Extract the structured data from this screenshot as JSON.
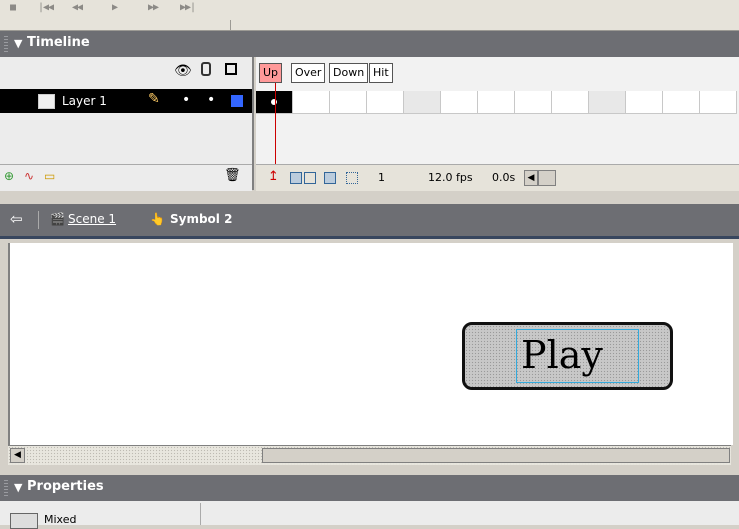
{
  "toolbar": {
    "buttons": [
      "stop-icon",
      "rewind-icon",
      "step-back-icon",
      "play-icon",
      "step-forward-icon",
      "go-end-icon"
    ]
  },
  "timeline": {
    "title": "Timeline",
    "layer": {
      "name": "Layer 1",
      "color": "#3366ff"
    },
    "frame_labels": [
      "Up",
      "Over",
      "Down",
      "Hit"
    ],
    "active_label": "Up",
    "current_frame": "1",
    "fps": "12.0 fps",
    "elapsed": "0.0s"
  },
  "nav": {
    "scene": "Scene 1",
    "symbol": "Symbol 2"
  },
  "stage": {
    "button_text": "Play"
  },
  "properties": {
    "title": "Properties",
    "mixed_label": "Mixed"
  },
  "colors": {
    "panel_header": "#6d6e73",
    "frame_up_highlight": "#ff9999",
    "playhead": "#cc0000",
    "selection": "#33aadd"
  }
}
